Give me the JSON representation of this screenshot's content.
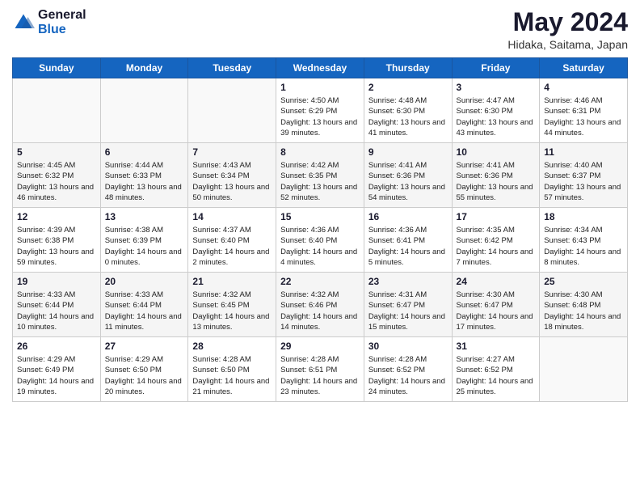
{
  "header": {
    "logo_general": "General",
    "logo_blue": "Blue",
    "month_title": "May 2024",
    "location": "Hidaka, Saitama, Japan"
  },
  "days_of_week": [
    "Sunday",
    "Monday",
    "Tuesday",
    "Wednesday",
    "Thursday",
    "Friday",
    "Saturday"
  ],
  "weeks": [
    {
      "days": [
        {
          "number": "",
          "empty": true
        },
        {
          "number": "",
          "empty": true
        },
        {
          "number": "",
          "empty": true
        },
        {
          "number": "1",
          "sunrise": "4:50 AM",
          "sunset": "6:29 PM",
          "daylight": "13 hours and 39 minutes."
        },
        {
          "number": "2",
          "sunrise": "4:48 AM",
          "sunset": "6:30 PM",
          "daylight": "13 hours and 41 minutes."
        },
        {
          "number": "3",
          "sunrise": "4:47 AM",
          "sunset": "6:30 PM",
          "daylight": "13 hours and 43 minutes."
        },
        {
          "number": "4",
          "sunrise": "4:46 AM",
          "sunset": "6:31 PM",
          "daylight": "13 hours and 44 minutes."
        }
      ]
    },
    {
      "days": [
        {
          "number": "5",
          "sunrise": "4:45 AM",
          "sunset": "6:32 PM",
          "daylight": "13 hours and 46 minutes."
        },
        {
          "number": "6",
          "sunrise": "4:44 AM",
          "sunset": "6:33 PM",
          "daylight": "13 hours and 48 minutes."
        },
        {
          "number": "7",
          "sunrise": "4:43 AM",
          "sunset": "6:34 PM",
          "daylight": "13 hours and 50 minutes."
        },
        {
          "number": "8",
          "sunrise": "4:42 AM",
          "sunset": "6:35 PM",
          "daylight": "13 hours and 52 minutes."
        },
        {
          "number": "9",
          "sunrise": "4:41 AM",
          "sunset": "6:36 PM",
          "daylight": "13 hours and 54 minutes."
        },
        {
          "number": "10",
          "sunrise": "4:41 AM",
          "sunset": "6:36 PM",
          "daylight": "13 hours and 55 minutes."
        },
        {
          "number": "11",
          "sunrise": "4:40 AM",
          "sunset": "6:37 PM",
          "daylight": "13 hours and 57 minutes."
        }
      ]
    },
    {
      "days": [
        {
          "number": "12",
          "sunrise": "4:39 AM",
          "sunset": "6:38 PM",
          "daylight": "13 hours and 59 minutes."
        },
        {
          "number": "13",
          "sunrise": "4:38 AM",
          "sunset": "6:39 PM",
          "daylight": "14 hours and 0 minutes."
        },
        {
          "number": "14",
          "sunrise": "4:37 AM",
          "sunset": "6:40 PM",
          "daylight": "14 hours and 2 minutes."
        },
        {
          "number": "15",
          "sunrise": "4:36 AM",
          "sunset": "6:40 PM",
          "daylight": "14 hours and 4 minutes."
        },
        {
          "number": "16",
          "sunrise": "4:36 AM",
          "sunset": "6:41 PM",
          "daylight": "14 hours and 5 minutes."
        },
        {
          "number": "17",
          "sunrise": "4:35 AM",
          "sunset": "6:42 PM",
          "daylight": "14 hours and 7 minutes."
        },
        {
          "number": "18",
          "sunrise": "4:34 AM",
          "sunset": "6:43 PM",
          "daylight": "14 hours and 8 minutes."
        }
      ]
    },
    {
      "days": [
        {
          "number": "19",
          "sunrise": "4:33 AM",
          "sunset": "6:44 PM",
          "daylight": "14 hours and 10 minutes."
        },
        {
          "number": "20",
          "sunrise": "4:33 AM",
          "sunset": "6:44 PM",
          "daylight": "14 hours and 11 minutes."
        },
        {
          "number": "21",
          "sunrise": "4:32 AM",
          "sunset": "6:45 PM",
          "daylight": "14 hours and 13 minutes."
        },
        {
          "number": "22",
          "sunrise": "4:32 AM",
          "sunset": "6:46 PM",
          "daylight": "14 hours and 14 minutes."
        },
        {
          "number": "23",
          "sunrise": "4:31 AM",
          "sunset": "6:47 PM",
          "daylight": "14 hours and 15 minutes."
        },
        {
          "number": "24",
          "sunrise": "4:30 AM",
          "sunset": "6:47 PM",
          "daylight": "14 hours and 17 minutes."
        },
        {
          "number": "25",
          "sunrise": "4:30 AM",
          "sunset": "6:48 PM",
          "daylight": "14 hours and 18 minutes."
        }
      ]
    },
    {
      "days": [
        {
          "number": "26",
          "sunrise": "4:29 AM",
          "sunset": "6:49 PM",
          "daylight": "14 hours and 19 minutes."
        },
        {
          "number": "27",
          "sunrise": "4:29 AM",
          "sunset": "6:50 PM",
          "daylight": "14 hours and 20 minutes."
        },
        {
          "number": "28",
          "sunrise": "4:28 AM",
          "sunset": "6:50 PM",
          "daylight": "14 hours and 21 minutes."
        },
        {
          "number": "29",
          "sunrise": "4:28 AM",
          "sunset": "6:51 PM",
          "daylight": "14 hours and 23 minutes."
        },
        {
          "number": "30",
          "sunrise": "4:28 AM",
          "sunset": "6:52 PM",
          "daylight": "14 hours and 24 minutes."
        },
        {
          "number": "31",
          "sunrise": "4:27 AM",
          "sunset": "6:52 PM",
          "daylight": "14 hours and 25 minutes."
        },
        {
          "number": "",
          "empty": true
        }
      ]
    }
  ],
  "labels": {
    "sunrise": "Sunrise:",
    "sunset": "Sunset:",
    "daylight": "Daylight:"
  }
}
